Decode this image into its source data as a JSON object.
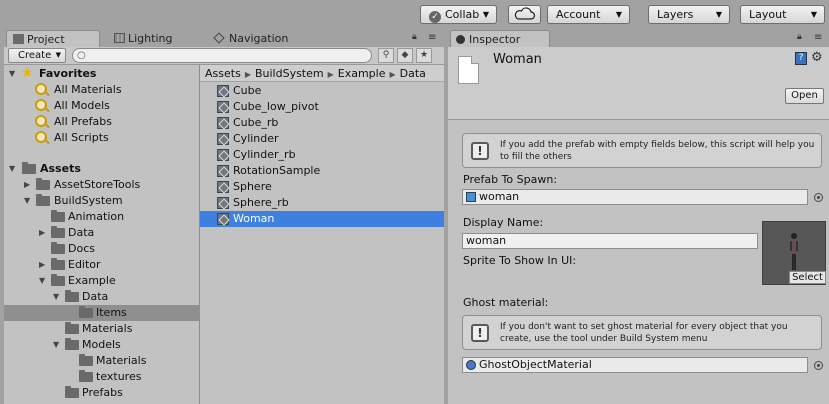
{
  "toolbar": {
    "collab_label": "Collab",
    "account_label": "Account",
    "layers_label": "Layers",
    "layout_label": "Layout"
  },
  "left_tabs": [
    {
      "label": "Project",
      "icon": "folder-icon"
    },
    {
      "label": "Lighting",
      "icon": "grid-icon"
    },
    {
      "label": "Navigation",
      "icon": "navigation-icon"
    }
  ],
  "project_toolbar": {
    "create_label": "Create",
    "search_value": ""
  },
  "tree": {
    "favorites": {
      "label": "Favorites",
      "items": [
        "All Materials",
        "All Models",
        "All Prefabs",
        "All Scripts"
      ]
    },
    "assets_label": "Assets",
    "folders": [
      {
        "label": "AssetStoreTools",
        "expanded": false,
        "selected": false
      },
      {
        "label": "BuildSystem",
        "expanded": true,
        "selected": false
      },
      {
        "label": "Animation",
        "expanded": null,
        "selected": false
      },
      {
        "label": "Data",
        "expanded": false,
        "selected": false
      },
      {
        "label": "Docs",
        "expanded": null,
        "selected": false
      },
      {
        "label": "Editor",
        "expanded": false,
        "selected": false
      },
      {
        "label": "Example",
        "expanded": true,
        "selected": false
      },
      {
        "label": "Data",
        "expanded": true,
        "selected": false
      },
      {
        "label": "Items",
        "expanded": null,
        "selected": true
      },
      {
        "label": "Materials",
        "expanded": null,
        "selected": false
      },
      {
        "label": "Models",
        "expanded": true,
        "selected": false
      },
      {
        "label": "Materials",
        "expanded": null,
        "selected": false
      },
      {
        "label": "textures",
        "expanded": null,
        "selected": false
      },
      {
        "label": "Prefabs",
        "expanded": null,
        "selected": false
      }
    ]
  },
  "breadcrumb": [
    "Assets",
    "BuildSystem",
    "Example",
    "Data"
  ],
  "files": [
    {
      "label": "Cube",
      "selected": false
    },
    {
      "label": "Cube_low_pivot",
      "selected": false
    },
    {
      "label": "Cube_rb",
      "selected": false
    },
    {
      "label": "Cylinder",
      "selected": false
    },
    {
      "label": "Cylinder_rb",
      "selected": false
    },
    {
      "label": "RotationSample",
      "selected": false
    },
    {
      "label": "Sphere",
      "selected": false
    },
    {
      "label": "Sphere_rb",
      "selected": false
    },
    {
      "label": "Woman",
      "selected": true
    }
  ],
  "inspector": {
    "tab_label": "Inspector",
    "object_name": "Woman",
    "open_label": "Open",
    "help_prefab": "If you add the prefab with empty fields below, this script will help you to fill the others",
    "prefab_label": "Prefab To Spawn:",
    "prefab_value": "woman",
    "display_label": "Display Name:",
    "display_value": "woman",
    "sprite_label": "Sprite To Show In UI:",
    "select_label": "Select",
    "ghost_label": "Ghost material:",
    "help_ghost": "If you don't want to set ghost material for every object that you create, use the tool under Build System menu",
    "ghost_value": "GhostObjectMaterial"
  },
  "colors": {
    "selection_blue": "#3d80df",
    "selection_gray": "#8f8f8f",
    "panel_bg": "#c2c2c2"
  }
}
